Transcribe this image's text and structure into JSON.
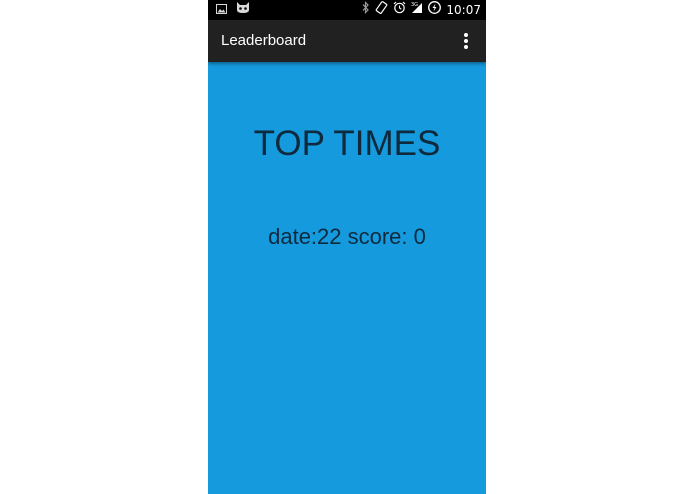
{
  "status_bar": {
    "time": "10:07",
    "icons_left": [
      "image-icon",
      "cat-icon"
    ],
    "icons_right": [
      "bluetooth-icon",
      "rotation-icon",
      "alarm-icon",
      "signal-3g-icon",
      "battery-charging-icon"
    ]
  },
  "app_bar": {
    "title": "Leaderboard",
    "overflow_icon": "more-vert-icon"
  },
  "content": {
    "heading": "TOP TIMES",
    "entries": [
      "date:22 score: 0"
    ]
  },
  "colors": {
    "background": "#159ade",
    "app_bar": "#212121",
    "status_bar": "#000000",
    "text": "#102a3d"
  }
}
